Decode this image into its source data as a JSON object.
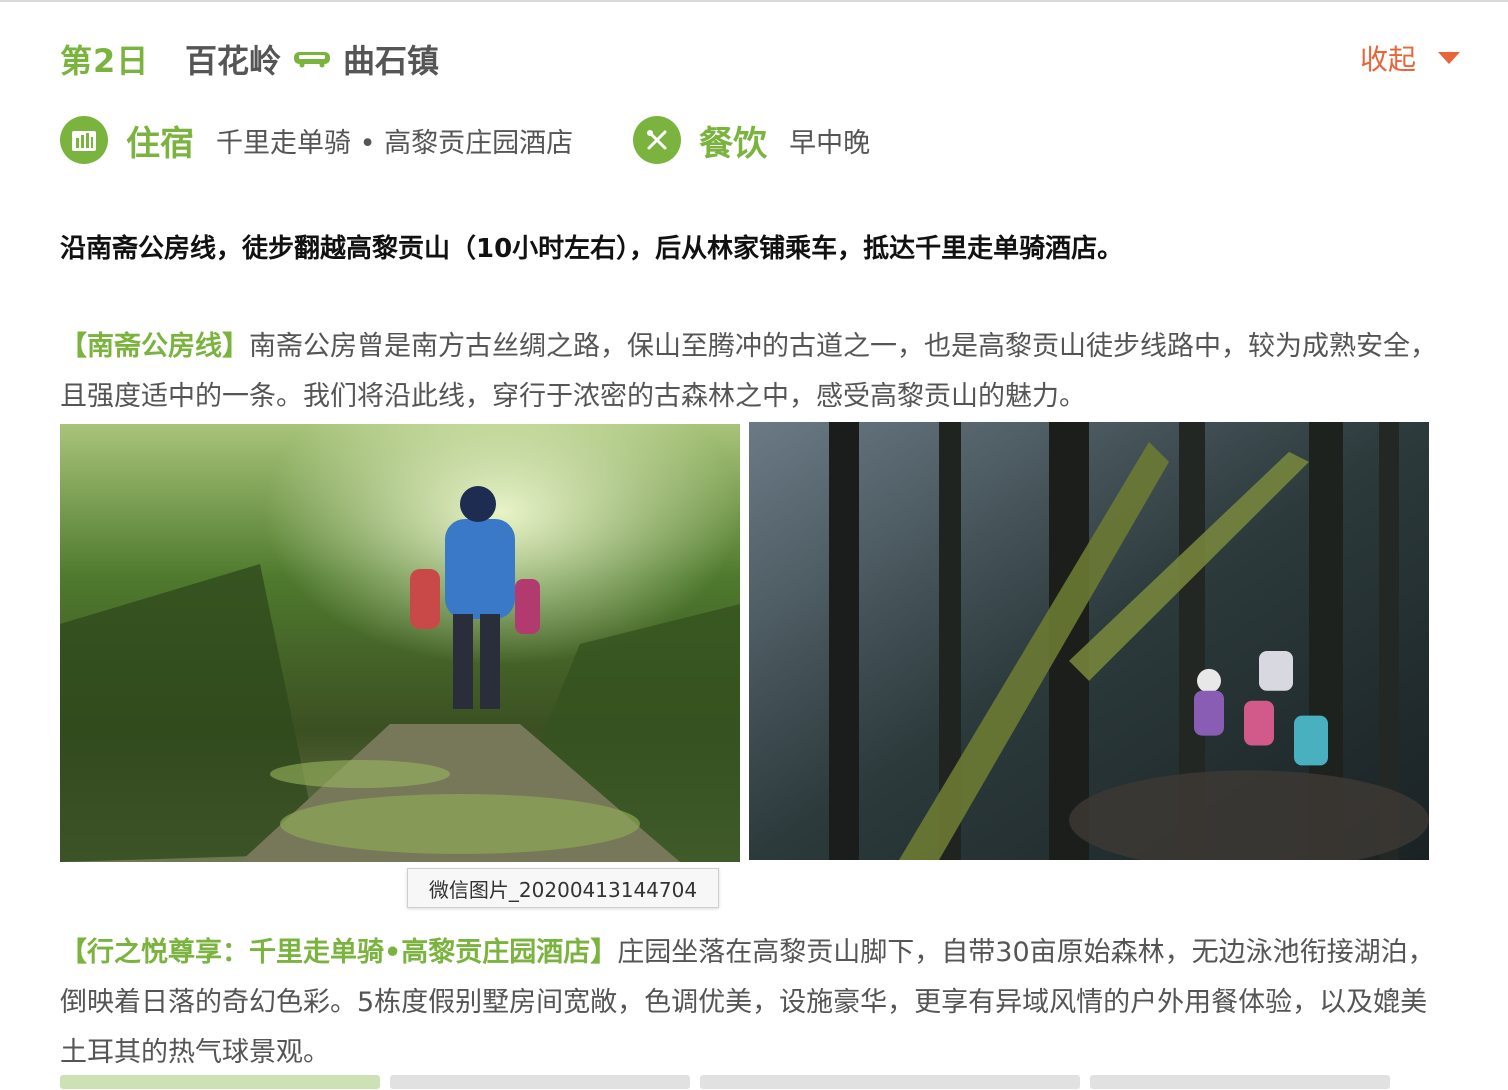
{
  "header": {
    "day": "第2日",
    "from": "百花岭",
    "to": "曲石镇",
    "collapse_label": "收起"
  },
  "meta": {
    "stay_label": "住宿",
    "stay_value": "千里走单骑 • 高黎贡庄园酒店",
    "meal_label": "餐饮",
    "meal_value": "早中晚"
  },
  "summary": "沿南斋公房线，徒步翻越高黎贡山（10小时左右），后从林家铺乘车，抵达千里走单骑酒店。",
  "section1": {
    "title": "【南斋公房线】",
    "body": "南斋公房曾是南方古丝绸之路，保山至腾冲的古道之一，也是高黎贡山徒步线路中，较为成熟安全，且强度适中的一条。我们将沿此线，穿行于浓密的古森林之中，感受高黎贡山的魅力。"
  },
  "photos": {
    "tooltip": "微信图片_20200413144704"
  },
  "section2": {
    "title": "【行之悦尊享：千里走单骑•高黎贡庄园酒店】",
    "body": "庄园坐落在高黎贡山脚下，自带30亩原始森林，无边泳池衔接湖泊，倒映着日落的奇幻色彩。5栋度假别墅房间宽敞，色调优美，设施豪华，更享有异域风情的户外用餐体验，以及媲美土耳其的热气球景观。"
  },
  "colors": {
    "accent_green": "#7bb33f",
    "accent_orange": "#e8653a"
  },
  "icons": [
    "bus-icon",
    "hotel-icon",
    "dining-icon",
    "chevron-down-icon"
  ]
}
